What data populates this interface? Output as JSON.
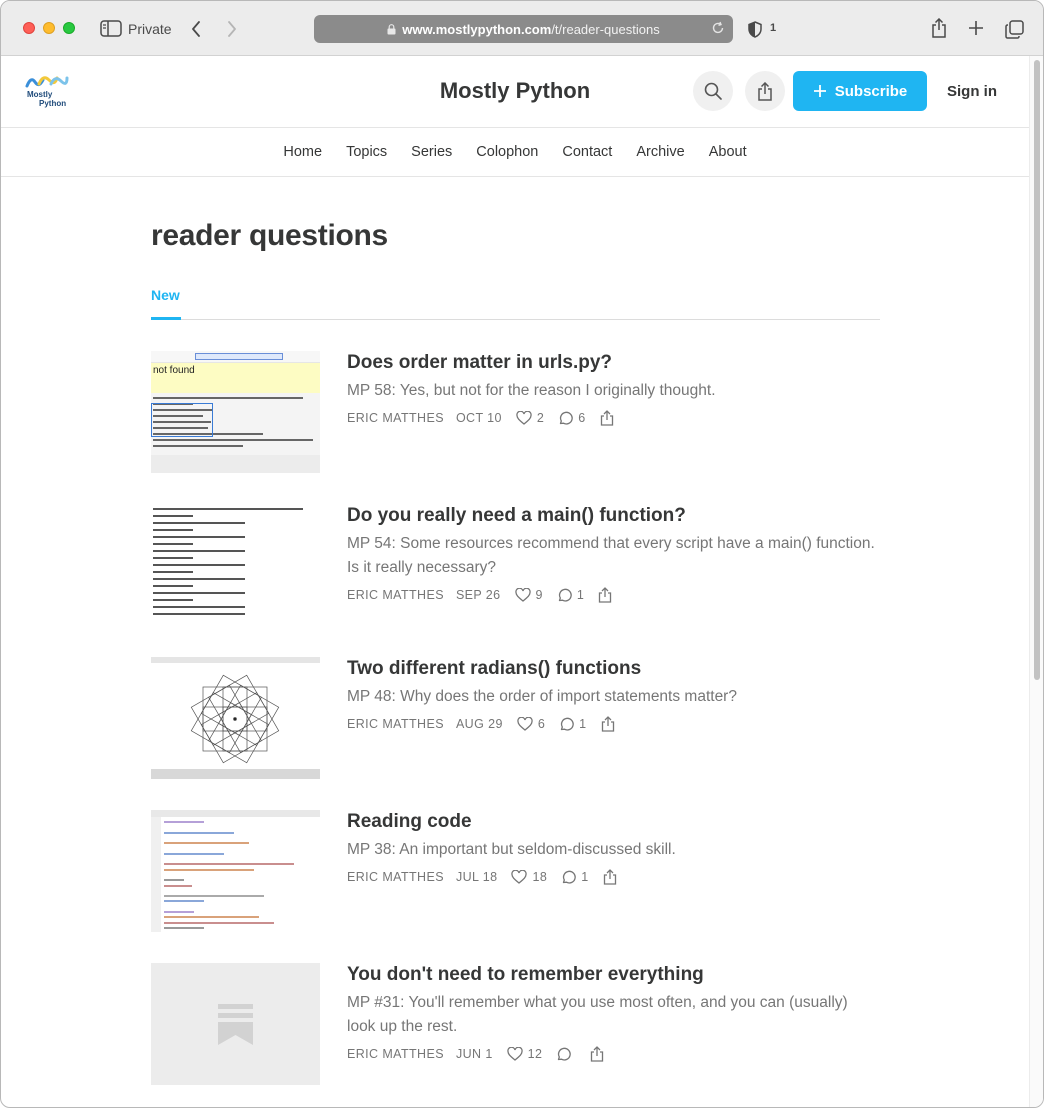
{
  "browser": {
    "private_label": "Private",
    "url_host": "www.mostlypython.com",
    "url_path": "/t/reader-questions",
    "tracker_count": "1"
  },
  "site": {
    "title": "Mostly Python",
    "logo_line1": "Mostly",
    "logo_line2": "Python",
    "subscribe_label": "Subscribe",
    "signin_label": "Sign in",
    "nav": [
      "Home",
      "Topics",
      "Series",
      "Colophon",
      "Contact",
      "Archive",
      "About"
    ]
  },
  "page": {
    "title": "reader questions",
    "tab_new": "New",
    "thumb1_text": "not found",
    "posts": [
      {
        "title": "Does order matter in urls.py?",
        "subtitle": "MP 58: Yes, but not for the reason I originally thought.",
        "author": "ERIC MATTHES",
        "date": "OCT 10",
        "likes": "2",
        "comments": "6"
      },
      {
        "title": "Do you really need a main() function?",
        "subtitle": "MP 54: Some resources recommend that every script have a main() function. Is it really necessary?",
        "author": "ERIC MATTHES",
        "date": "SEP 26",
        "likes": "9",
        "comments": "1"
      },
      {
        "title": "Two different radians() functions",
        "subtitle": "MP 48: Why does the order of import statements matter?",
        "author": "ERIC MATTHES",
        "date": "AUG 29",
        "likes": "6",
        "comments": "1"
      },
      {
        "title": "Reading code",
        "subtitle": "MP 38: An important but seldom-discussed skill.",
        "author": "ERIC MATTHES",
        "date": "JUL 18",
        "likes": "18",
        "comments": "1"
      },
      {
        "title": "You don't need to remember everything",
        "subtitle": "MP #31: You'll remember what you use most often, and you can (usually) look up the rest.",
        "author": "ERIC MATTHES",
        "date": "JUN 1",
        "likes": "12",
        "comments": ""
      }
    ]
  },
  "colors": {
    "accent": "#1fb5f2",
    "text": "#363737",
    "muted": "#767676"
  }
}
